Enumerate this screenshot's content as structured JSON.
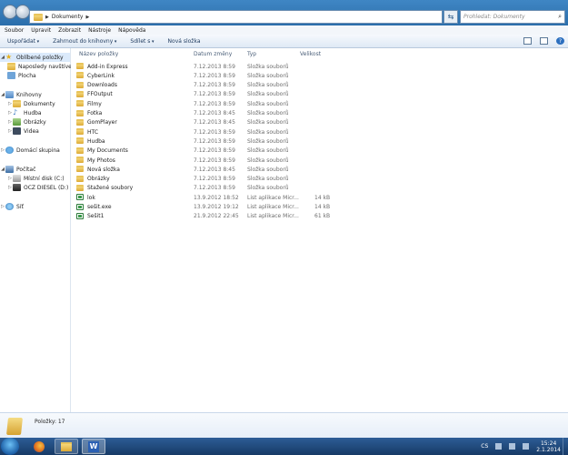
{
  "address": {
    "crumbs": [
      "Dokumenty"
    ],
    "search_placeholder": "Prohledat: Dokumenty"
  },
  "menu": [
    "Soubor",
    "Upravit",
    "Zobrazit",
    "Nástroje",
    "Nápověda"
  ],
  "toolbar": {
    "organize": "Uspořádat",
    "include_library": "Zahrnout do knihovny",
    "share": "Sdílet s",
    "new_folder": "Nová složka"
  },
  "sidebar": {
    "favorites": "Oblíbené položky",
    "recent": "Naposledy navštíver",
    "desktop": "Plocha",
    "libraries": "Knihovny",
    "documents": "Dokumenty",
    "music": "Hudba",
    "pictures": "Obrázky",
    "videos": "Videa",
    "homegroup": "Domácí skupina",
    "computer": "Počítač",
    "local_disk": "Místní disk (C:)",
    "ocz_disk": "OCZ DIESEL (D:)",
    "network": "Síť"
  },
  "columns": {
    "name": "Název položky",
    "date": "Datum změny",
    "type": "Typ",
    "size": "Velikost"
  },
  "files": [
    {
      "name": "Add-in Express",
      "date": "7.12.2013 8:59",
      "type": "Složka souborů",
      "size": "",
      "kind": "folder"
    },
    {
      "name": "CyberLink",
      "date": "7.12.2013 8:59",
      "type": "Složka souborů",
      "size": "",
      "kind": "folder"
    },
    {
      "name": "Downloads",
      "date": "7.12.2013 8:59",
      "type": "Složka souborů",
      "size": "",
      "kind": "folder"
    },
    {
      "name": "FFOutput",
      "date": "7.12.2013 8:59",
      "type": "Složka souborů",
      "size": "",
      "kind": "folder"
    },
    {
      "name": "Filmy",
      "date": "7.12.2013 8:59",
      "type": "Složka souborů",
      "size": "",
      "kind": "folder"
    },
    {
      "name": "Fotka",
      "date": "7.12.2013 8:45",
      "type": "Složka souborů",
      "size": "",
      "kind": "folder"
    },
    {
      "name": "GomPlayer",
      "date": "7.12.2013 8:45",
      "type": "Složka souborů",
      "size": "",
      "kind": "folder"
    },
    {
      "name": "HTC",
      "date": "7.12.2013 8:59",
      "type": "Složka souborů",
      "size": "",
      "kind": "folder"
    },
    {
      "name": "Hudba",
      "date": "7.12.2013 8:59",
      "type": "Složka souborů",
      "size": "",
      "kind": "folder"
    },
    {
      "name": "My Documents",
      "date": "7.12.2013 8:59",
      "type": "Složka souborů",
      "size": "",
      "kind": "folder"
    },
    {
      "name": "My Photos",
      "date": "7.12.2013 8:59",
      "type": "Složka souborů",
      "size": "",
      "kind": "folder"
    },
    {
      "name": "Nová složka",
      "date": "7.12.2013 8:45",
      "type": "Složka souborů",
      "size": "",
      "kind": "folder"
    },
    {
      "name": "Obrázky",
      "date": "7.12.2013 8:59",
      "type": "Složka souborů",
      "size": "",
      "kind": "folder"
    },
    {
      "name": "Stažené soubory",
      "date": "7.12.2013 8:59",
      "type": "Složka souborů",
      "size": "",
      "kind": "folder"
    },
    {
      "name": "lok",
      "date": "13.9.2012 18:52",
      "type": "List aplikace Micr...",
      "size": "14 kB",
      "kind": "xls"
    },
    {
      "name": "sešit.exe",
      "date": "13.9.2012 19:12",
      "type": "List aplikace Micr...",
      "size": "14 kB",
      "kind": "xls"
    },
    {
      "name": "Sešit1",
      "date": "21.9.2012 22:45",
      "type": "List aplikace Micr...",
      "size": "61 kB",
      "kind": "xls"
    }
  ],
  "details": {
    "count": "Položky: 17"
  },
  "taskbar": {
    "language": "CS",
    "time": "15:24",
    "date": "2.1.2014"
  }
}
